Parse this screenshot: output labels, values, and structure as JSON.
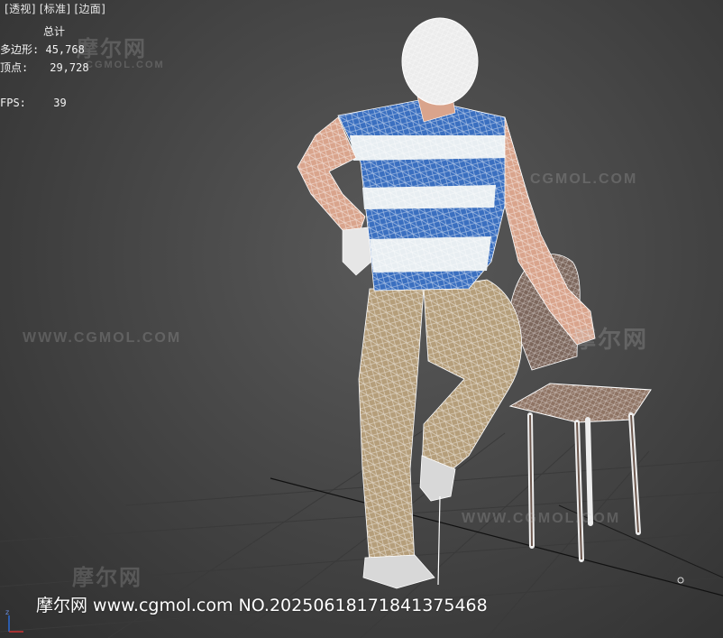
{
  "viewport": {
    "labels": [
      "[透视]",
      "[标准]",
      "[边面]"
    ],
    "label_prefix": "[",
    "stats": {
      "header": "总计",
      "polygons_label": "多边形:",
      "polygons_value": "45,768",
      "vertices_label": "顶点:",
      "vertices_value": "29,728",
      "fps_label": "FPS:",
      "fps_value": "39"
    }
  },
  "watermarks": {
    "logo_text": "摩尔网",
    "logo_sub": "CGMOL.COM",
    "site_text": "WWW.CGMOL.COM",
    "brand_text": "CGMOL.COM"
  },
  "footer": {
    "text": "摩尔网 www.cgmol.com NO.20250618171841375468"
  },
  "colors": {
    "shirt_blue": "#3a6fc0",
    "shirt_white": "#e8eef2",
    "pants": "#b59e7a",
    "skin": "#d9a48c",
    "chair_wood": "#8f7464",
    "wire": "#ffffff"
  }
}
